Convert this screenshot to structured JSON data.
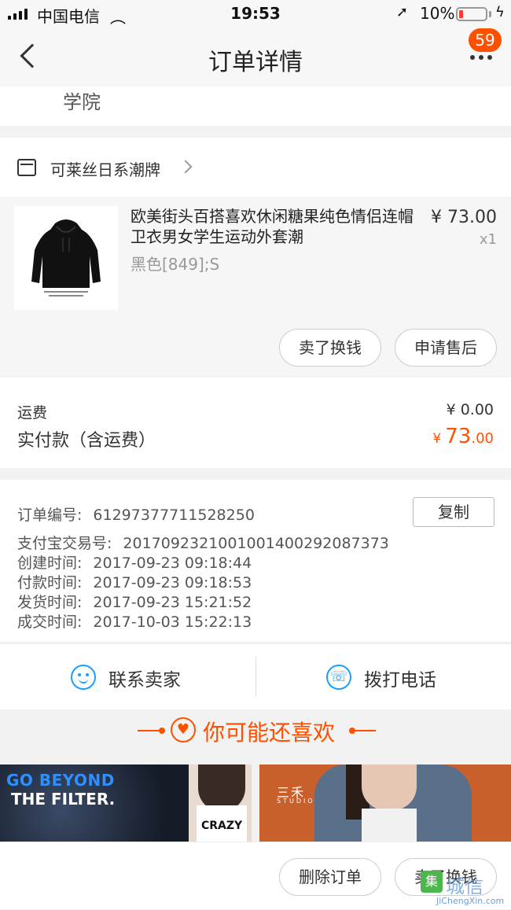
{
  "status_bar": {
    "carrier": "中国电信",
    "time": "19:53",
    "battery": "10%"
  },
  "nav": {
    "title": "订单详情",
    "badge": "59"
  },
  "address": {
    "tail": "学院"
  },
  "store": {
    "name": "可莱丝日系潮牌"
  },
  "product": {
    "title": "欧美街头百搭喜欢休闲糖果纯色情侣连帽卫衣男女学生运动外套潮",
    "sku": "黑色[849];S",
    "price": "¥ 73.00",
    "qty": "x1",
    "actions": [
      "卖了换钱",
      "申请售后"
    ]
  },
  "fees": {
    "shipping_label": "运费",
    "shipping_value": "¥ 0.00",
    "paid_label": "实付款（含运费）",
    "paid_currency": "¥",
    "paid_int": "73",
    "paid_dec": ".00"
  },
  "order_info": {
    "order_no_label": "订单编号:",
    "order_no": "61297377711528250",
    "copy_label": "复制",
    "alipay_label": "支付宝交易号:",
    "alipay_no": "2017092321001001400292087373",
    "created_label": "创建时间:",
    "created": "2017-09-23 09:18:44",
    "paid_label": "付款时间:",
    "paid": "2017-09-23 09:18:53",
    "shipped_label": "发货时间:",
    "shipped": "2017-09-23 15:21:52",
    "closed_label": "成交时间:",
    "closed": "2017-10-03 15:22:13"
  },
  "contact": {
    "seller": "联系卖家",
    "call": "拨打电话"
  },
  "recommend": {
    "title": "你可能还喜欢",
    "card1_line1": "GO BEYOND",
    "card1_line2": "THE FILTER.",
    "card1_shirt": "CRAZY",
    "card2_brand": "三禾",
    "card2_sub": "STUDIO"
  },
  "bottom": {
    "delete": "删除订单",
    "sell": "卖了换钱"
  },
  "watermark": {
    "cn": "城信",
    "en": "JiChengXin.com"
  },
  "colors": {
    "accent": "#ff5000",
    "blue": "#1a9fff"
  }
}
